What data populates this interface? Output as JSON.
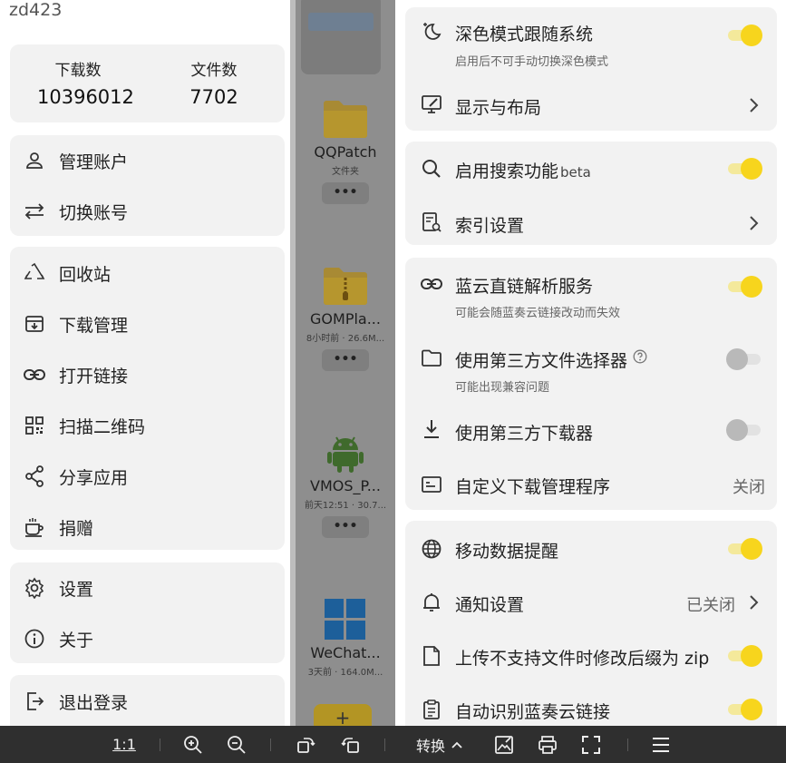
{
  "drawer": {
    "username": "zd423",
    "stats": {
      "downloads_label": "下载数",
      "downloads_value": "10396012",
      "files_label": "文件数",
      "files_value": "7702"
    },
    "account_menu": [
      {
        "label": "管理账户",
        "icon": "user-icon"
      },
      {
        "label": "切换账号",
        "icon": "swap-icon"
      }
    ],
    "tools_menu": [
      {
        "label": "回收站",
        "icon": "recycle-icon"
      },
      {
        "label": "下载管理",
        "icon": "download-box-icon"
      },
      {
        "label": "打开链接",
        "icon": "link-icon"
      },
      {
        "label": "扫描二维码",
        "icon": "qr-code-icon"
      },
      {
        "label": "分享应用",
        "icon": "share-icon"
      },
      {
        "label": "捐赠",
        "icon": "coffee-icon"
      }
    ],
    "settings_menu": [
      {
        "label": "设置",
        "icon": "gear-icon"
      },
      {
        "label": "关于",
        "icon": "info-icon"
      }
    ],
    "logout_label": "退出登录"
  },
  "files": [
    {
      "name": "QQPatch",
      "meta": "文件夹",
      "icon": "folder-icon"
    },
    {
      "name": "GOMPla...",
      "meta": "8小时前 · 26.6M...",
      "icon": "zip-folder-icon"
    },
    {
      "name": "VMOS_P...",
      "meta": "前天12:51 · 30.7...",
      "icon": "android-icon"
    },
    {
      "name": "WeChat...",
      "meta": "3天前 · 164.0M...",
      "icon": "windows-icon"
    }
  ],
  "settings": {
    "dark_mode": {
      "title": "深色模式跟随系统",
      "subtitle": "启用后不可手动切换深色模式",
      "enabled": true
    },
    "display_layout": {
      "title": "显示与布局"
    },
    "search": {
      "title": "启用搜索功能",
      "badge": "beta",
      "enabled": true
    },
    "index": {
      "title": "索引设置"
    },
    "direct_link": {
      "title": "蓝云直链解析服务",
      "subtitle": "可能会随蓝奏云链接改动而失效",
      "enabled": true
    },
    "third_party_picker": {
      "title": "使用第三方文件选择器",
      "subtitle": "可能出现兼容问题",
      "enabled": false
    },
    "third_party_downloader": {
      "title": "使用第三方下载器",
      "enabled": false
    },
    "custom_download_manager": {
      "title": "自定义下载管理程序",
      "value": "关闭"
    },
    "mobile_data": {
      "title": "移动数据提醒",
      "enabled": true
    },
    "notifications": {
      "title": "通知设置",
      "value": "已关闭"
    },
    "zip_suffix": {
      "title": "上传不支持文件时修改后缀为 zip",
      "enabled": true
    },
    "auto_detect": {
      "title": "自动识别蓝奏云链接",
      "enabled": true
    }
  },
  "toolbar": {
    "zoom_ratio": "1:1",
    "convert_label": "转换"
  },
  "colors": {
    "accent_toggle": "#f7d51d",
    "card_bg": "#f2f2f2",
    "toolbar_bg": "#2f2f2f"
  }
}
